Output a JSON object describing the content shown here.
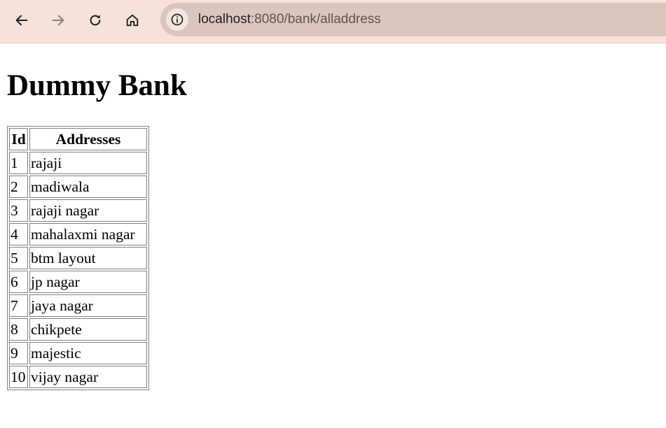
{
  "browser": {
    "url_host": "localhost",
    "url_rest": ":8080/bank/alladdress",
    "icons": {
      "back": "arrow-left-icon",
      "forward": "arrow-right-icon",
      "reload": "reload-icon",
      "home": "home-icon",
      "site_info": "info-icon"
    }
  },
  "page": {
    "title": "Dummy Bank"
  },
  "table": {
    "headers": [
      "Id",
      "Addresses"
    ],
    "rows": [
      [
        "1",
        "rajaji"
      ],
      [
        "2",
        "madiwala"
      ],
      [
        "3",
        "rajaji nagar"
      ],
      [
        "4",
        "mahalaxmi nagar"
      ],
      [
        "5",
        "btm layout"
      ],
      [
        "6",
        "jp nagar"
      ],
      [
        "7",
        "jaya nagar"
      ],
      [
        "8",
        "chikpete"
      ],
      [
        "9",
        "majestic"
      ],
      [
        "10",
        "vijay nagar"
      ]
    ]
  }
}
